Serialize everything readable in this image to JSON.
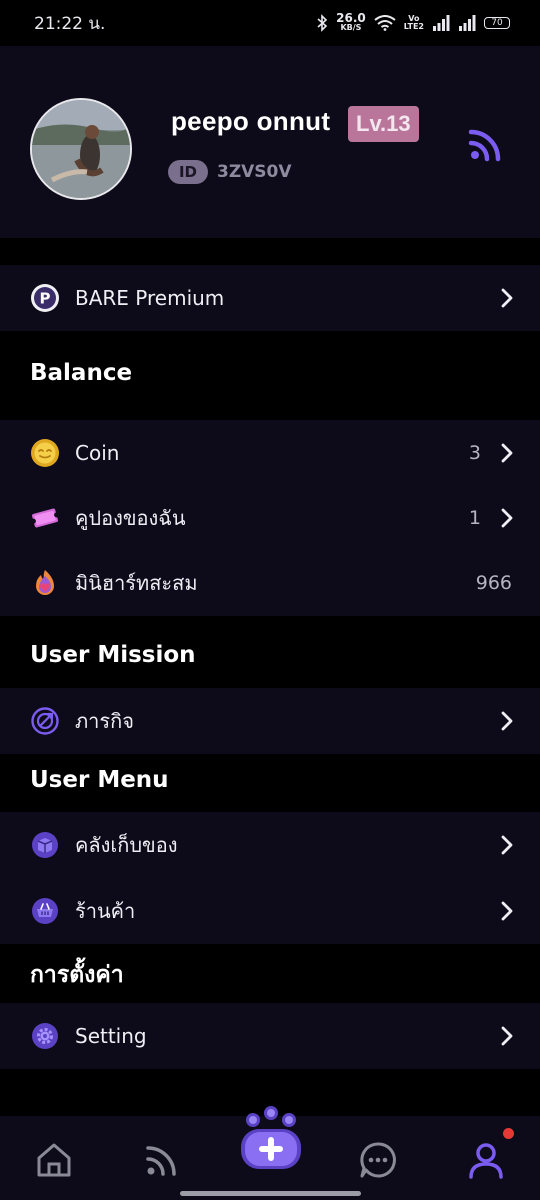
{
  "status_bar": {
    "time": "21:22 น.",
    "net_speed_value": "26.0",
    "net_speed_unit": "KB/S",
    "volte_top": "Vo",
    "volte_bottom": "LTE2",
    "battery": "70",
    "icons": [
      "bluetooth-icon",
      "wifi-icon",
      "signal-icon",
      "signal-icon",
      "battery-icon"
    ]
  },
  "profile": {
    "username": "peepo onnut",
    "level": "Lv.13",
    "id_label": "ID",
    "id_value": "3ZVS0V",
    "feed_icon": "rss-feed-icon"
  },
  "premium": {
    "label": "BARE Premium",
    "icon": "premium-p-icon"
  },
  "balance": {
    "title": "Balance",
    "items": [
      {
        "label": "Coin",
        "value": "3",
        "icon": "coin-icon",
        "chevron": true
      },
      {
        "label": "คูปองของฉัน",
        "value": "1",
        "icon": "coupon-icon",
        "chevron": true
      },
      {
        "label": "มินิฮาร์ทสะสม",
        "value": "966",
        "icon": "mini-heart-icon",
        "chevron": false
      }
    ]
  },
  "user_mission": {
    "title": "User Mission",
    "items": [
      {
        "label": "ภารกิจ",
        "icon": "mission-icon"
      }
    ]
  },
  "user_menu": {
    "title": "User Menu",
    "items": [
      {
        "label": "คลังเก็บของ",
        "icon": "inventory-box-icon"
      },
      {
        "label": "ร้านค้า",
        "icon": "shop-basket-icon"
      }
    ]
  },
  "settings": {
    "title": "การตั้งค่า",
    "items": [
      {
        "label": "Setting",
        "icon": "gear-icon"
      }
    ]
  },
  "bottom_nav": {
    "items": [
      "home-icon",
      "feed-icon",
      "create-paw-icon",
      "chat-icon",
      "profile-icon"
    ],
    "active": "profile-icon"
  },
  "colors": {
    "background": "#000000",
    "panel": "#0d0b19",
    "accent": "#7b5cf0",
    "level_badge": "#b9769a",
    "notification": "#e53935"
  }
}
